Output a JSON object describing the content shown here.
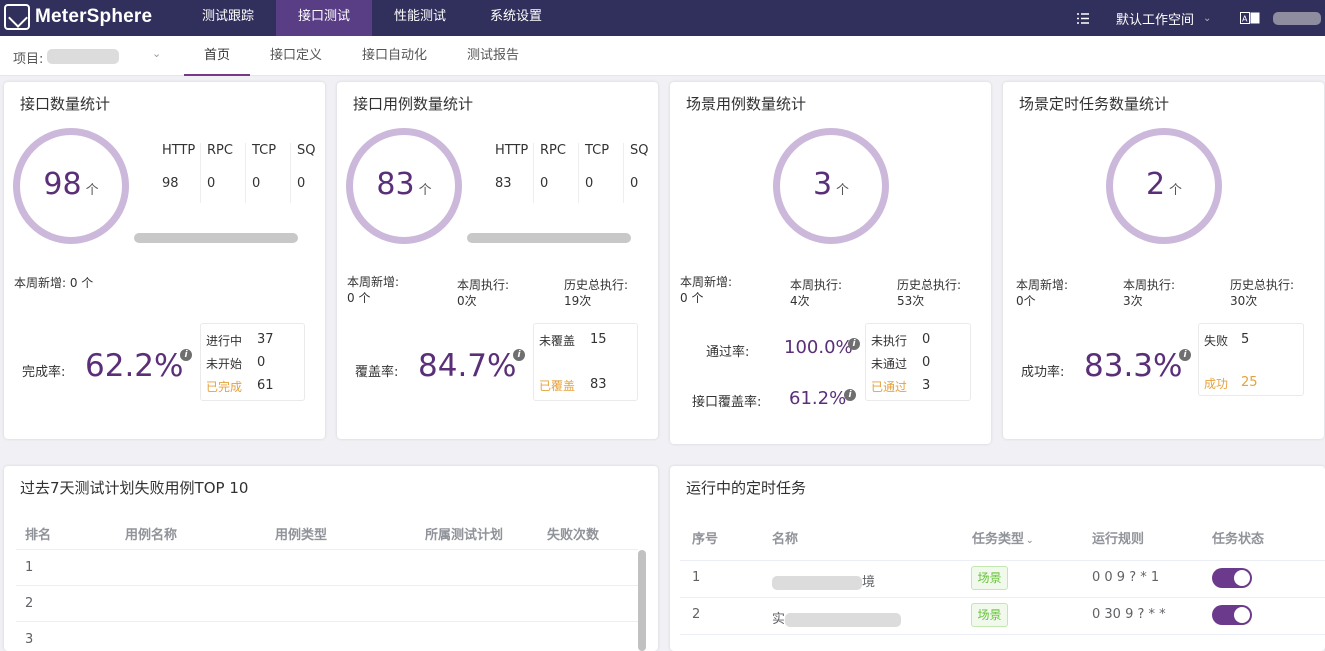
{
  "app": {
    "brand": "MeterSphere"
  },
  "topnav": [
    "测试跟踪",
    "接口测试",
    "性能测试",
    "系统设置"
  ],
  "topnav_active": 1,
  "header": {
    "workspace": "默认工作空间"
  },
  "subbar": {
    "project_label": "项目:",
    "tabs": [
      "首页",
      "接口定义",
      "接口自动化",
      "测试报告"
    ],
    "active_tab": 0
  },
  "cards": {
    "api_count": {
      "title": "接口数量统计",
      "count": "98",
      "unit": "个",
      "protocols": [
        {
          "name": "HTTP",
          "value": "98"
        },
        {
          "name": "RPC",
          "value": "0"
        },
        {
          "name": "TCP",
          "value": "0"
        },
        {
          "name": "SQ",
          "value": "0"
        }
      ],
      "week_new": "本周新增: 0 个",
      "rate_label": "完成率:",
      "rate_value": "62.2%",
      "status": [
        {
          "label": "进行中",
          "value": "37"
        },
        {
          "label": "未开始",
          "value": "0"
        },
        {
          "label": "已完成",
          "value": "61"
        }
      ]
    },
    "case_count": {
      "title": "接口用例数量统计",
      "count": "83",
      "unit": "个",
      "protocols": [
        {
          "name": "HTTP",
          "value": "83"
        },
        {
          "name": "RPC",
          "value": "0"
        },
        {
          "name": "TCP",
          "value": "0"
        },
        {
          "name": "SQ",
          "value": "0"
        }
      ],
      "week_new_label": "本周新增:",
      "week_new_value": "0 个",
      "week_exec_label": "本周执行:",
      "week_exec_value": "0次",
      "total_exec_label": "历史总执行:",
      "total_exec_value": "19次",
      "rate_label": "覆盖率:",
      "rate_value": "84.7%",
      "status": [
        {
          "label": "未覆盖",
          "value": "15"
        },
        {
          "label": "已覆盖",
          "value": "83"
        }
      ]
    },
    "scenario_count": {
      "title": "场景用例数量统计",
      "count": "3",
      "unit": "个",
      "week_new_label": "本周新增:",
      "week_new_value": "0 个",
      "week_exec_label": "本周执行:",
      "week_exec_value": "4次",
      "total_exec_label": "历史总执行:",
      "total_exec_value": "53次",
      "pass_label": "通过率:",
      "pass_value": "100.0%",
      "cover_label": "接口覆盖率:",
      "cover_value": "61.2%",
      "status": [
        {
          "label": "未执行",
          "value": "0"
        },
        {
          "label": "未通过",
          "value": "0"
        },
        {
          "label": "已通过",
          "value": "3"
        }
      ]
    },
    "schedule_count": {
      "title": "场景定时任务数量统计",
      "count": "2",
      "unit": "个",
      "week_new_label": "本周新增:",
      "week_new_value": "0个",
      "week_exec_label": "本周执行:",
      "week_exec_value": "3次",
      "total_exec_label": "历史总执行:",
      "total_exec_value": "30次",
      "rate_label": "成功率:",
      "rate_value": "83.3%",
      "status": [
        {
          "label": "失败",
          "value": "5"
        },
        {
          "label": "成功",
          "value": "25"
        }
      ]
    }
  },
  "fail_top": {
    "title": "过去7天测试计划失败用例TOP 10",
    "columns": [
      "排名",
      "用例名称",
      "用例类型",
      "所属测试计划",
      "失败次数"
    ],
    "rows": [
      "1",
      "2",
      "3"
    ]
  },
  "running_tasks": {
    "title": "运行中的定时任务",
    "columns": [
      "序号",
      "名称",
      "任务类型",
      "运行规则",
      "任务状态"
    ],
    "rows": [
      {
        "index": "1",
        "name_prefix": "",
        "name_suffix": "境",
        "type": "场景",
        "rule": "0 0 9 ? * 1"
      },
      {
        "index": "2",
        "name_prefix": "实",
        "name_suffix": "",
        "type": "场景",
        "rule": "0 30 9 ? * *"
      }
    ]
  }
}
